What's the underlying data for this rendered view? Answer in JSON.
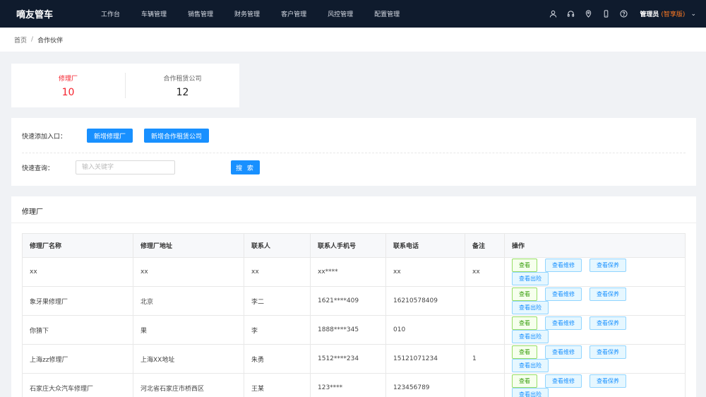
{
  "header": {
    "logo": "嘀友管车",
    "nav": [
      "工作台",
      "车辆管理",
      "销售管理",
      "财务管理",
      "客户管理",
      "风控管理",
      "配置管理"
    ],
    "icons": [
      "user-icon",
      "headset-icon",
      "location-pin-icon",
      "phone-icon",
      "help-icon"
    ],
    "user_name": "管理员",
    "user_edition": "(智享版)",
    "caret": "⌄"
  },
  "breadcrumb": {
    "home": "首页",
    "separator": "/",
    "current": "合作伙伴"
  },
  "stats": [
    {
      "label": "修理厂",
      "value": "10"
    },
    {
      "label": "合作租赁公司",
      "value": "12"
    }
  ],
  "quick": {
    "add_label": "快速添加入口：",
    "add_repair_button": "新增修理厂",
    "add_lease_button": "新增合作租赁公司",
    "search_label": "快速查询：",
    "search_placeholder": "输入关键字",
    "search_button": "搜 索"
  },
  "panel": {
    "title": "修理厂",
    "columns": [
      "修理厂名称",
      "修理厂地址",
      "联系人",
      "联系人手机号",
      "联系电话",
      "备注",
      "操作"
    ],
    "actions": [
      "查看",
      "查看维修",
      "查看保养",
      "查看出险"
    ],
    "rows": [
      [
        "xx",
        "xx",
        "xx",
        "xx****",
        "xx",
        "xx"
      ],
      [
        "象牙果修理厂",
        "北京",
        "李二",
        "1621****409",
        "16210578409",
        ""
      ],
      [
        "你猜下",
        "果",
        "李",
        "1888****345",
        "010",
        ""
      ],
      [
        "上海zz修理厂",
        "上海XX地址",
        "朱勇",
        "1512****234",
        "15121071234",
        "1"
      ],
      [
        "石家庄大众汽车修理厂",
        "河北省石家庄市桥西区",
        "王某",
        "123****",
        "123456789",
        ""
      ]
    ]
  },
  "colors": {
    "topbar": "#0f1b2d",
    "primary": "#1890ff",
    "active_stat": "#f5222d",
    "edition": "#ff7a22"
  }
}
